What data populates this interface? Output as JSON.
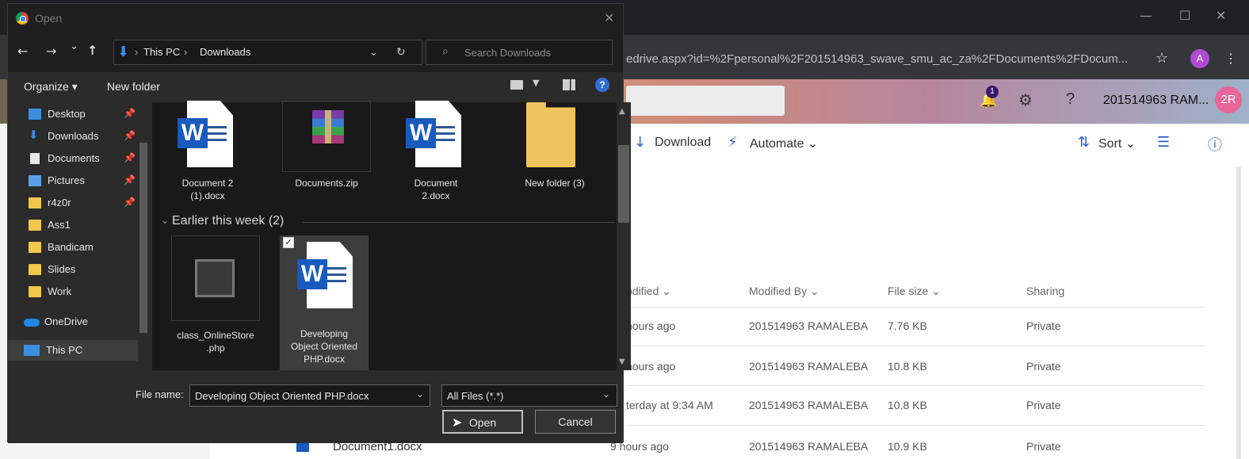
{
  "browser": {
    "url": "edrive.aspx?id=%2Fpersonal%2F201514963_swave_smu_ac_za%2FDocuments%2FDocum...",
    "profile_initial": "A",
    "window_controls": {
      "minimize": "—",
      "maximize": "☐",
      "close": "✕"
    },
    "star_icon": "☆",
    "menu_icon": "⋮"
  },
  "sharepoint": {
    "notifications_count": "1",
    "help": "?",
    "user_name": "201514963 RAM...",
    "user_initials": "2R",
    "commands": {
      "download": "Download",
      "automate": "Automate",
      "sort": "Sort"
    },
    "columns": {
      "modified": "odified",
      "modified_by": "Modified By",
      "file_size": "File size",
      "sharing": "Sharing"
    },
    "rows": [
      {
        "modified": "hours ago",
        "modified_by": "201514963 RAMALEBA",
        "size": "7.76 KB",
        "sharing": "Private"
      },
      {
        "modified": "hours ago",
        "modified_by": "201514963 RAMALEBA",
        "size": "10.8 KB",
        "sharing": "Private"
      },
      {
        "modified": "terday at 9:34 AM",
        "modified_by": "201514963 RAMALEBA",
        "size": "10.8 KB",
        "sharing": "Private"
      },
      {
        "name": "Document1.docx",
        "modified": "9 hours ago",
        "modified_by": "201514963 RAMALEBA",
        "size": "10.9 KB",
        "sharing": "Private"
      }
    ]
  },
  "dialog": {
    "title": "Open",
    "close": "✕",
    "nav": {
      "back": "←",
      "forward": "→",
      "recent": "⌄",
      "up": "↑",
      "refresh": "↻"
    },
    "path": [
      "This PC",
      "Downloads"
    ],
    "search_placeholder": "Search Downloads",
    "toolbar": {
      "organize": "Organize ▾",
      "new_folder": "New folder"
    },
    "sidebar": [
      {
        "label": "Desktop",
        "icon": "desktop-icon"
      },
      {
        "label": "Downloads",
        "icon": "download-arrow-icon"
      },
      {
        "label": "Documents",
        "icon": "documents-icon"
      },
      {
        "label": "Pictures",
        "icon": "pictures-icon"
      },
      {
        "label": "r4z0r",
        "icon": "folder-icon"
      },
      {
        "label": "Ass1",
        "icon": "folder-icon"
      },
      {
        "label": "Bandicam",
        "icon": "folder-icon"
      },
      {
        "label": "Slides",
        "icon": "folder-icon"
      },
      {
        "label": "Work",
        "icon": "folder-icon"
      },
      {
        "label": "OneDrive",
        "icon": "cloud-icon"
      },
      {
        "label": "This PC",
        "icon": "computer-icon"
      }
    ],
    "files_top": [
      {
        "name": "Document 2\n(1).docx",
        "type": "word"
      },
      {
        "name": "Documents.zip",
        "type": "zip"
      },
      {
        "name": "Document\n2.docx",
        "type": "word"
      },
      {
        "name": "New folder (3)",
        "type": "folder"
      }
    ],
    "group_label": "Earlier this week (2)",
    "files_group": [
      {
        "name": "class_OnlineStore\n.php",
        "type": "php"
      },
      {
        "name": "Developing\nObject Oriented\nPHP.docx",
        "type": "word"
      }
    ],
    "file_name_label": "File name:",
    "file_name_value": "Developing Object Oriented PHP.docx",
    "filter_value": "All Files (*.*)",
    "open_label": "Open",
    "cancel_label": "Cancel"
  }
}
